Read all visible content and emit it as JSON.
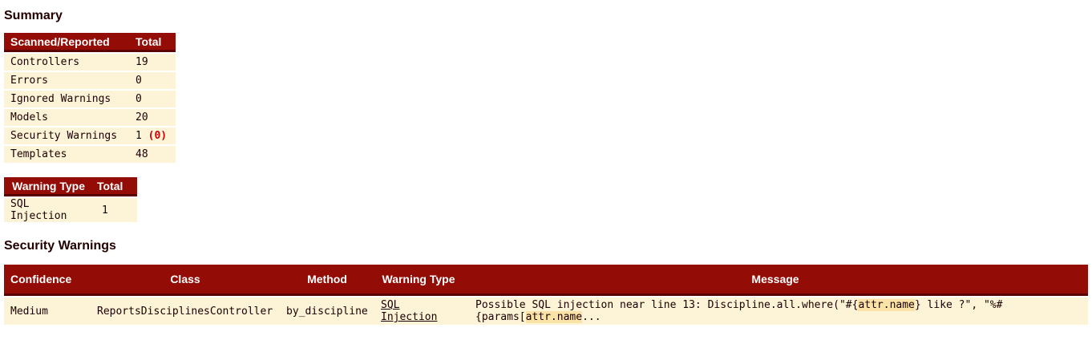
{
  "summary": {
    "heading": "Summary",
    "scan_table": {
      "headers": [
        "Scanned/Reported",
        "Total"
      ],
      "rows": [
        {
          "label": "Controllers",
          "value": "19"
        },
        {
          "label": "Errors",
          "value": "0"
        },
        {
          "label": "Ignored Warnings",
          "value": "0"
        },
        {
          "label": "Models",
          "value": "20"
        },
        {
          "label": "Security Warnings",
          "value": "1",
          "extra": "(0)"
        },
        {
          "label": "Templates",
          "value": "48"
        }
      ]
    },
    "warning_type_table": {
      "headers": [
        "Warning Type",
        "Total"
      ],
      "rows": [
        {
          "label": "SQL Injection",
          "value": "1"
        }
      ]
    }
  },
  "security_warnings": {
    "heading": "Security Warnings",
    "headers": [
      "Confidence",
      "Class",
      "Method",
      "Warning Type",
      "Message"
    ],
    "rows": [
      {
        "confidence": "Medium",
        "class": "ReportsDisciplinesController",
        "method": "by_discipline",
        "warning_type": "SQL Injection",
        "message_prefix": "Possible SQL injection near line 13: Discipline.all.where(\"#{",
        "message_hl1": "attr.name",
        "message_mid": "} like ?\", \"%#{params[",
        "message_hl2": "attr.name",
        "message_suffix": "..."
      }
    ]
  },
  "colors": {
    "header_bg": "#930c06",
    "header_border": "#5a0302",
    "row_bg": "#fdf3d6",
    "highlight": "#fbe3a8",
    "ignored_red": "#cc0000"
  }
}
